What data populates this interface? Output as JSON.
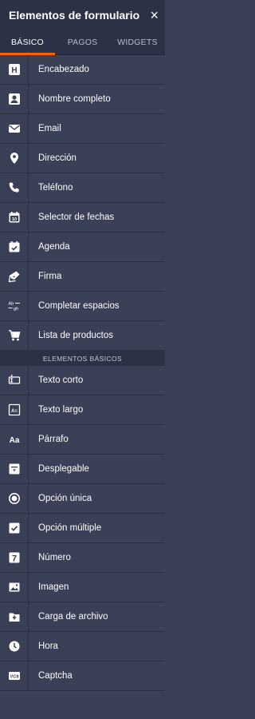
{
  "header": {
    "title": "Elementos de formulario",
    "close_symbol": "×"
  },
  "tabs": [
    {
      "label": "BÁSICO",
      "active": true
    },
    {
      "label": "PAGOS",
      "active": false
    },
    {
      "label": "WIDGETS",
      "active": false
    }
  ],
  "items_top": [
    {
      "label": "Encabezado",
      "icon": "heading-icon"
    },
    {
      "label": "Nombre completo",
      "icon": "contact-card-icon"
    },
    {
      "label": "Email",
      "icon": "envelope-icon"
    },
    {
      "label": "Dirección",
      "icon": "map-pin-icon"
    },
    {
      "label": "Teléfono",
      "icon": "phone-icon"
    },
    {
      "label": "Selector de fechas",
      "icon": "calendar-icon"
    },
    {
      "label": "Agenda",
      "icon": "calendar-check-icon"
    },
    {
      "label": "Firma",
      "icon": "pen-icon"
    },
    {
      "label": "Completar espacios",
      "icon": "fill-blank-icon"
    },
    {
      "label": "Lista de productos",
      "icon": "cart-icon"
    }
  ],
  "section_label": "ELEMENTOS BÁSICOS",
  "items_basic": [
    {
      "label": "Texto corto",
      "icon": "short-text-icon"
    },
    {
      "label": "Texto largo",
      "icon": "long-text-icon"
    },
    {
      "label": "Párrafo",
      "icon": "paragraph-icon",
      "glyph": "Aa"
    },
    {
      "label": "Desplegable",
      "icon": "dropdown-icon"
    },
    {
      "label": "Opción única",
      "icon": "radio-icon"
    },
    {
      "label": "Opción múltiple",
      "icon": "checkbox-icon"
    },
    {
      "label": "Número",
      "icon": "number-icon",
      "glyph": "7"
    },
    {
      "label": "Imagen",
      "icon": "image-icon"
    },
    {
      "label": "Carga de archivo",
      "icon": "folder-upload-icon"
    },
    {
      "label": "Hora",
      "icon": "clock-icon"
    },
    {
      "label": "Captcha",
      "icon": "captcha-icon"
    }
  ],
  "icon_glyphs": {
    "heading": "H",
    "fill_top": "Ab",
    "fill_bottom": "gh",
    "long_text": "A≡",
    "captcha": "VC8"
  }
}
